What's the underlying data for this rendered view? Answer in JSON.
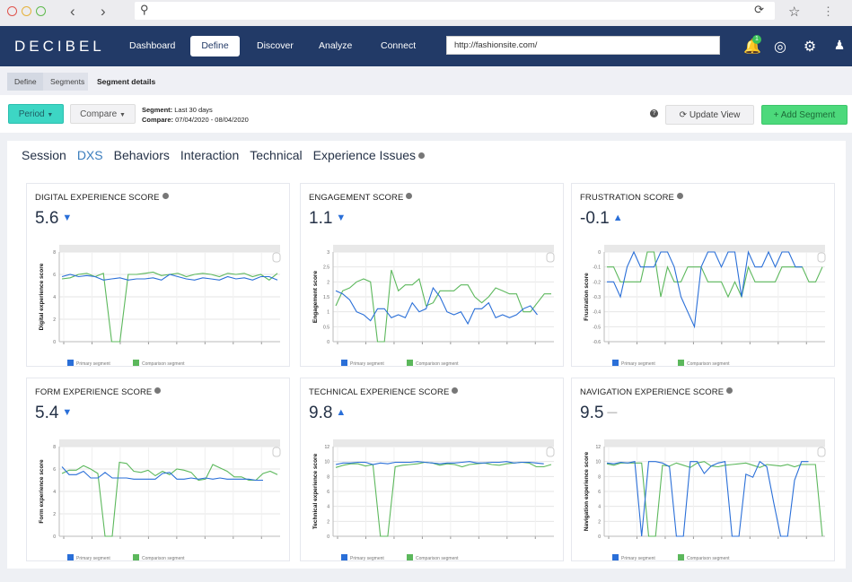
{
  "browser": {
    "url": ""
  },
  "app": {
    "logo": "DECIBEL",
    "nav": [
      "Dashboard",
      "Define",
      "Discover",
      "Analyze",
      "Connect"
    ],
    "active_nav": "Define",
    "site_url": "http://fashionsite.com/",
    "notification_count": "1"
  },
  "breadcrumb": [
    "Define",
    "Segments",
    "Segment details"
  ],
  "toolbar": {
    "period_label": "Period",
    "compare_label": "Compare",
    "segment_label": "Segment:",
    "segment_value": "Last 30 days",
    "compare_info_label": "Compare:",
    "compare_info_value": "07/04/2020 - 08/04/2020",
    "update_view": "Update View",
    "add_segment": "+ Add Segment"
  },
  "tabs": [
    "Session",
    "DXS",
    "Behaviors",
    "Interaction",
    "Technical",
    "Experience Issues"
  ],
  "active_tab": "DXS",
  "colors": {
    "primary": "#2a6fd8",
    "comparison": "#5cb85c",
    "accent": "#3dd6c4",
    "add": "#4cd97b",
    "nav": "#223a67"
  },
  "legend": {
    "primary": "Primary segment",
    "comparison": "Comparison segment"
  },
  "chart_data": [
    {
      "type": "line",
      "title": "DIGITAL EXPERIENCE SCORE",
      "value": "5.6",
      "trend": "down",
      "ylabel": "Digital experience score",
      "ylim": [
        0,
        8
      ],
      "yticks": [
        0,
        2,
        4,
        6,
        8
      ],
      "series": [
        {
          "name": "Primary segment",
          "values": [
            5.8,
            6,
            5.8,
            5.9,
            5.8,
            5.5,
            5.6,
            5.7,
            5.5,
            5.6,
            5.6,
            5.7,
            5.5,
            6,
            5.8,
            5.6,
            5.5,
            5.7,
            5.6,
            5.5,
            5.8,
            5.6,
            5.7,
            5.5,
            5.8,
            5.8,
            5.5
          ]
        },
        {
          "name": "Comparison segment",
          "values": [
            5.6,
            5.7,
            6,
            6.1,
            5.8,
            6.1,
            0,
            0,
            6,
            6,
            6.1,
            6.2,
            5.9,
            6,
            6.1,
            5.8,
            6,
            6.1,
            6,
            5.8,
            6.1,
            6,
            6.1,
            5.8,
            6,
            5.5,
            6.1
          ]
        }
      ]
    },
    {
      "type": "line",
      "title": "ENGAGEMENT SCORE",
      "value": "1.1",
      "trend": "down",
      "ylabel": "Engagement score",
      "ylim": [
        0,
        3
      ],
      "yticks": [
        0,
        0.5,
        1,
        1.5,
        2,
        2.5,
        3
      ],
      "series": [
        {
          "name": "Primary segment",
          "values": [
            1.7,
            1.6,
            1.4,
            1,
            0.9,
            0.7,
            1.1,
            1.1,
            0.8,
            0.9,
            0.8,
            1.3,
            1,
            1.1,
            1.8,
            1.5,
            1,
            0.9,
            1,
            0.6,
            1.1,
            1.1,
            1.3,
            0.8,
            0.9,
            0.8,
            0.9,
            1.1,
            1.2,
            0.9
          ]
        },
        {
          "name": "Comparison segment",
          "values": [
            1.2,
            1.7,
            1.8,
            2,
            2.1,
            2,
            0,
            0,
            2.4,
            1.7,
            1.9,
            1.9,
            2.1,
            1.2,
            1.3,
            1.7,
            1.7,
            1.7,
            1.9,
            1.9,
            1.5,
            1.3,
            1.5,
            1.8,
            1.7,
            1.6,
            1.6,
            1,
            1,
            1.3,
            1.6,
            1.6
          ]
        }
      ]
    },
    {
      "type": "line",
      "title": "FRUSTRATION SCORE",
      "value": "-0.1",
      "trend": "up",
      "ylabel": "Frustration score",
      "ylim": [
        -0.6,
        0
      ],
      "yticks": [
        -0.6,
        -0.5,
        -0.4,
        -0.3,
        -0.2,
        -0.1,
        0
      ],
      "series": [
        {
          "name": "Primary segment",
          "values": [
            -0.2,
            -0.2,
            -0.3,
            -0.1,
            0,
            -0.1,
            -0.1,
            -0.1,
            0,
            0,
            -0.1,
            -0.3,
            -0.4,
            -0.5,
            -0.1,
            0,
            0,
            -0.1,
            0,
            0,
            -0.3,
            0,
            -0.1,
            -0.1,
            0,
            -0.1,
            0,
            0,
            -0.1,
            -0.1
          ]
        },
        {
          "name": "Comparison segment",
          "values": [
            -0.1,
            -0.1,
            -0.2,
            -0.2,
            -0.2,
            -0.2,
            0,
            0,
            -0.3,
            -0.1,
            -0.2,
            -0.2,
            -0.1,
            -0.1,
            -0.1,
            -0.2,
            -0.2,
            -0.2,
            -0.3,
            -0.2,
            -0.3,
            -0.1,
            -0.2,
            -0.2,
            -0.2,
            -0.2,
            -0.1,
            -0.1,
            -0.1,
            -0.1,
            -0.2,
            -0.2,
            -0.1
          ]
        }
      ]
    },
    {
      "type": "line",
      "title": "FORM EXPERIENCE SCORE",
      "value": "5.4",
      "trend": "down",
      "ylabel": "Form experience score",
      "ylim": [
        0,
        8
      ],
      "yticks": [
        0,
        2,
        4,
        6,
        8
      ],
      "series": [
        {
          "name": "Primary segment",
          "values": [
            6.2,
            5.5,
            5.5,
            5.8,
            5.2,
            5.2,
            5.7,
            5.2,
            5.2,
            5.2,
            5.1,
            5.1,
            5.1,
            5.1,
            5.6,
            5.7,
            5.1,
            5.1,
            5.2,
            5.1,
            5.2,
            5.1,
            5.2,
            5.1,
            5.1,
            5.1,
            5.1,
            5,
            5
          ]
        },
        {
          "name": "Comparison segment",
          "values": [
            5.6,
            5.9,
            5.9,
            6.3,
            6,
            5.6,
            0,
            0,
            6.6,
            6.5,
            5.8,
            5.7,
            5.9,
            5.4,
            5.8,
            5.5,
            6,
            5.9,
            5.7,
            5,
            5.1,
            6.4,
            6.1,
            5.8,
            5.3,
            5.3,
            5,
            5,
            5.6,
            5.8,
            5.5
          ]
        }
      ]
    },
    {
      "type": "line",
      "title": "TECHNICAL EXPERIENCE SCORE",
      "value": "9.8",
      "trend": "up",
      "ylabel": "Technical experience score",
      "ylim": [
        0,
        12
      ],
      "yticks": [
        0,
        2,
        4,
        6,
        8,
        10,
        12
      ],
      "series": [
        {
          "name": "Primary segment",
          "values": [
            9.6,
            9.8,
            9.8,
            9.9,
            9.9,
            9.6,
            9.8,
            9.7,
            9.9,
            9.9,
            9.9,
            10,
            9.9,
            9.8,
            9.7,
            9.8,
            9.8,
            9.9,
            10,
            9.8,
            9.8,
            9.9,
            9.9,
            10,
            9.8,
            9.9,
            9.9,
            9.8,
            9.7
          ]
        },
        {
          "name": "Comparison segment",
          "values": [
            9.2,
            9.5,
            9.7,
            9.7,
            9.4,
            9.6,
            0,
            0,
            9.3,
            9.5,
            9.6,
            9.7,
            9.9,
            9.8,
            9.5,
            9.7,
            9.6,
            9.3,
            9.6,
            9.7,
            9.8,
            9.6,
            9.5,
            9.7,
            9.8,
            9.9,
            9.8,
            9.3,
            9.3,
            9.6
          ]
        }
      ]
    },
    {
      "type": "line",
      "title": "NAVIGATION EXPERIENCE SCORE",
      "value": "9.5",
      "trend": "flat",
      "ylabel": "Navigation experience score",
      "ylim": [
        0,
        12
      ],
      "yticks": [
        0,
        2,
        4,
        6,
        8,
        10,
        12
      ],
      "series": [
        {
          "name": "Primary segment",
          "values": [
            9.8,
            9.7,
            9.9,
            9.8,
            10,
            0,
            10,
            10,
            9.8,
            9.3,
            0,
            0,
            10,
            10,
            8.4,
            9.4,
            9.8,
            10,
            0,
            0,
            8.3,
            7.9,
            10,
            9.3,
            4.5,
            0,
            0,
            7.5,
            10,
            10
          ]
        },
        {
          "name": "Comparison segment",
          "values": [
            9.7,
            9.5,
            9.8,
            9.8,
            9.8,
            9.8,
            0,
            0,
            9.5,
            9.4,
            9.8,
            9.5,
            9.2,
            9.8,
            10,
            9.4,
            9.3,
            9.5,
            9.6,
            9.7,
            9.8,
            9.5,
            9.2,
            9.6,
            9.5,
            9.4,
            9.6,
            9.3,
            9.6,
            9.6,
            9.6,
            0
          ]
        }
      ]
    }
  ]
}
